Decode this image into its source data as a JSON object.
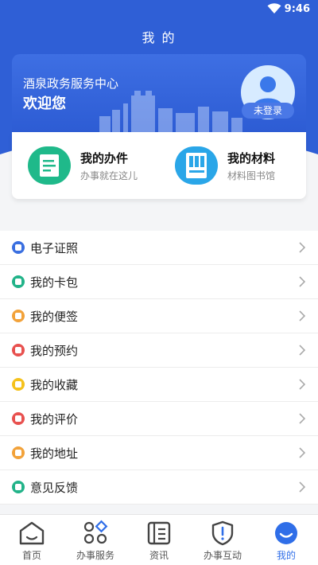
{
  "status_bar": {
    "time": "9:46"
  },
  "page": {
    "title": "我 的"
  },
  "banner": {
    "center_name": "酒泉政务服务中心",
    "welcome": "欢迎您",
    "login_status": "未登录"
  },
  "cards": [
    {
      "title": "我的办件",
      "subtitle": "办事就在这儿",
      "icon": "folder-document-icon",
      "color": "#1fb98a"
    },
    {
      "title": "我的材料",
      "subtitle": "材料图书馆",
      "icon": "book-shelf-icon",
      "color": "#2aa6e8"
    }
  ],
  "menu": {
    "items": [
      {
        "label": "电子证照",
        "icon": "id-card-icon",
        "color": "#3a6fe0"
      },
      {
        "label": "我的卡包",
        "icon": "wallet-icon",
        "color": "#22b389"
      },
      {
        "label": "我的便签",
        "icon": "note-icon",
        "color": "#f2a23a"
      },
      {
        "label": "我的预约",
        "icon": "calendar-icon",
        "color": "#e8514f"
      },
      {
        "label": "我的收藏",
        "icon": "star-icon",
        "color": "#f5c21c"
      },
      {
        "label": "我的评价",
        "icon": "comment-icon",
        "color": "#e8514f"
      },
      {
        "label": "我的地址",
        "icon": "location-icon",
        "color": "#f2a23a"
      },
      {
        "label": "意见反馈",
        "icon": "feedback-icon",
        "color": "#22b389"
      }
    ]
  },
  "tabbar": {
    "items": [
      {
        "label": "首页",
        "icon": "home-icon"
      },
      {
        "label": "办事服务",
        "icon": "services-grid-icon"
      },
      {
        "label": "资讯",
        "icon": "news-icon"
      },
      {
        "label": "办事互动",
        "icon": "shield-alert-icon"
      },
      {
        "label": "我的",
        "icon": "profile-smile-icon",
        "active": true
      }
    ],
    "active_color": "#2f6ee8"
  },
  "colors": {
    "primary": "#2f5fd6",
    "background": "#f4f5f7"
  }
}
